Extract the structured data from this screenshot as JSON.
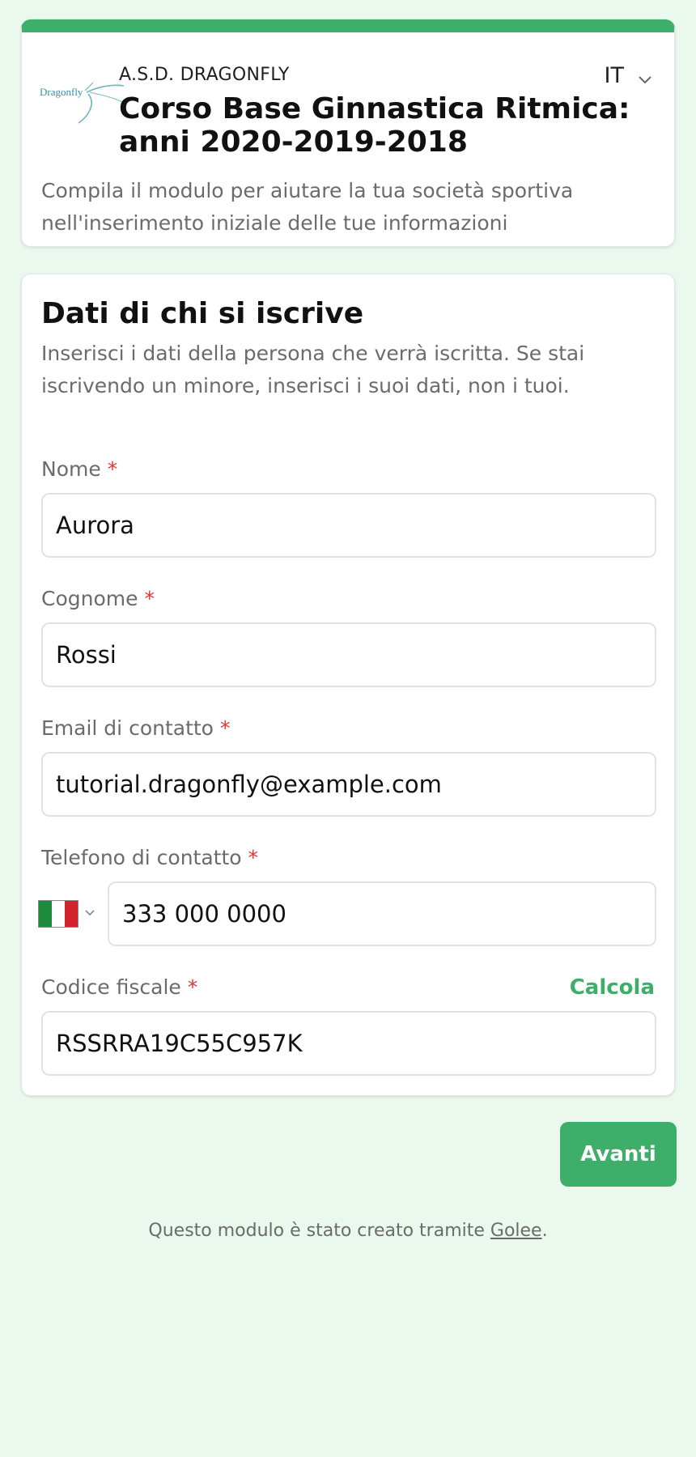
{
  "header": {
    "organization": "A.S.D. DRAGONFLY",
    "logo_text": "Dragonfly",
    "title": "Corso Base Ginnastica Ritmica: anni 2020-2019-2018",
    "subtitle": "Compila il modulo per aiutare la tua società sportiva nell'inserimento iniziale delle tue informazioni",
    "language": "IT"
  },
  "section": {
    "title": "Dati di chi si iscrive",
    "description": "Inserisci i dati della persona che verrà iscritta. Se stai iscrivendo un minore, inserisci i suoi dati, non i tuoi."
  },
  "fields": {
    "nome": {
      "label": "Nome",
      "required": "*",
      "value": "Aurora"
    },
    "cognome": {
      "label": "Cognome",
      "required": "*",
      "value": "Rossi"
    },
    "email": {
      "label": "Email di contatto",
      "required": "*",
      "value": "tutorial.dragonfly@example.com"
    },
    "telefono": {
      "label": "Telefono di contatto",
      "required": "*",
      "value": "333 000 0000"
    },
    "codice_fiscale": {
      "label": "Codice fiscale",
      "required": "*",
      "value": "RSSRRA19C55C957K",
      "action": "Calcola"
    }
  },
  "actions": {
    "next_label": "Avanti"
  },
  "footer": {
    "text_before": "Questo modulo è stato creato tramite ",
    "link": "Golee",
    "text_after": "."
  },
  "colors": {
    "accent": "#3daf6a",
    "background": "#eaf8ee",
    "required": "#d23b3b"
  },
  "icons": {
    "language_chevron": "chevron-down-icon",
    "country_flag": "italy-flag-icon"
  }
}
